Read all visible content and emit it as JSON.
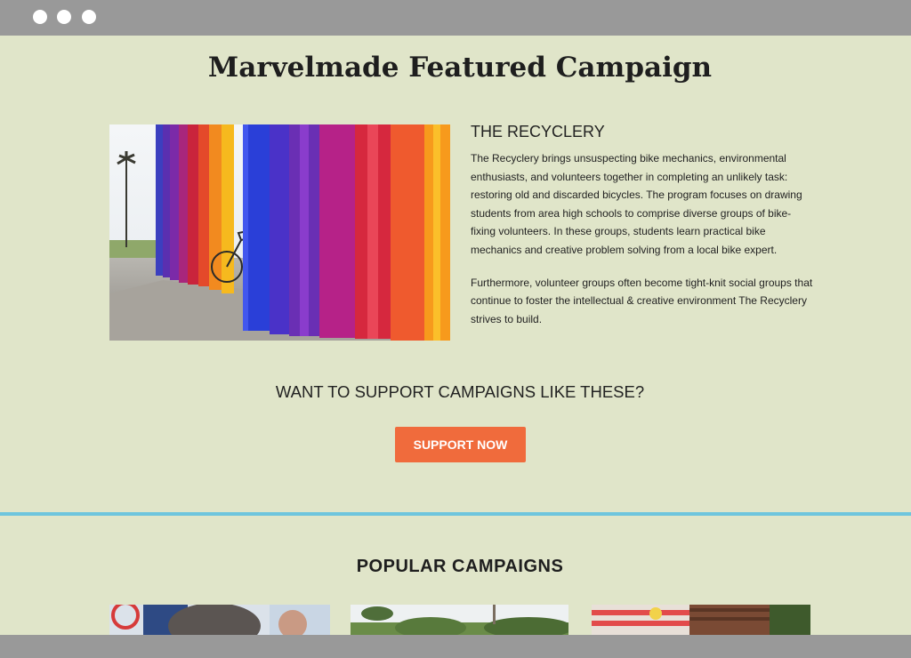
{
  "featured": {
    "title": "Marvelmade Featured Campaign",
    "campaign_name": "THE RECYCLERY",
    "paragraphs": [
      "The Recyclery brings unsuspecting bike mechanics, environmental enthusiasts, and volunteers together in completing an unlikely task: restoring old and discarded bicycles. The program focuses on drawing students from area high schools to comprise diverse groups of bike-fixing volunteers. In these groups, students learn practical bike mechanics and creative problem solving from a local bike expert.",
      "Furthermore, volunteer groups often become tight-knit social groups that continue to foster the intellectual & creative environment The Recyclery strives to build."
    ]
  },
  "cta": {
    "heading": "WANT TO SUPPORT CAMPAIGNS LIKE THESE?",
    "button_label": "SUPPORT NOW"
  },
  "popular": {
    "heading": "POPULAR CAMPAIGNS"
  },
  "colors": {
    "background": "#e0e5c9",
    "chrome": "#999999",
    "accent_button": "#f06b3c",
    "divider": "#6ec5dd"
  }
}
